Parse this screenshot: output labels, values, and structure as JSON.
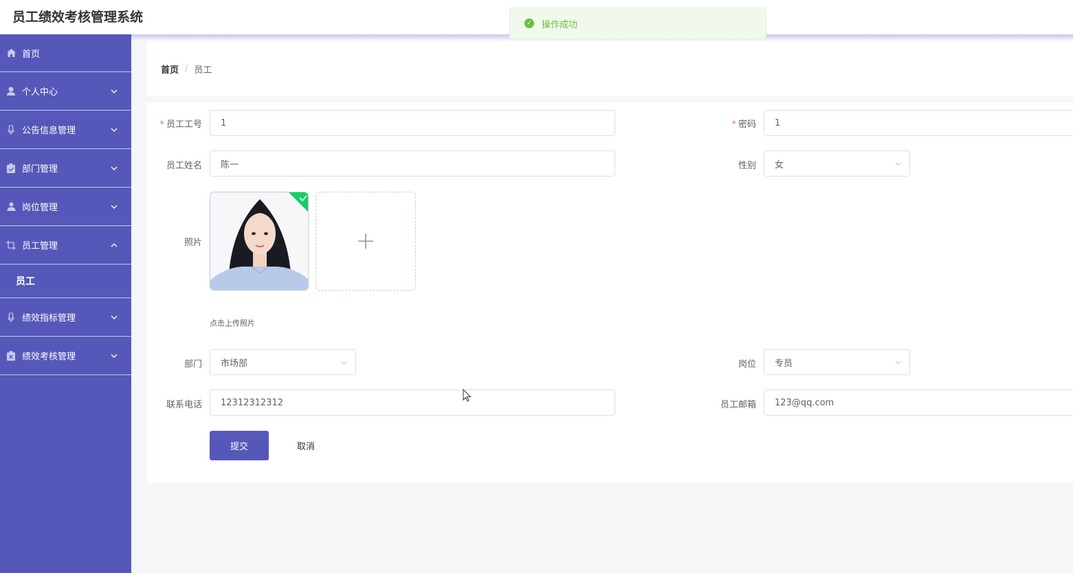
{
  "app": {
    "title": "员工绩效考核管理系统"
  },
  "toast": {
    "message": "操作成功",
    "color": "#67c23a"
  },
  "sidebar": {
    "color": "#5558b8",
    "items": [
      {
        "label": "首页",
        "icon": "home-icon"
      },
      {
        "label": "个人中心",
        "icon": "user-icon"
      },
      {
        "label": "公告信息管理",
        "icon": "microphone-icon"
      },
      {
        "label": "部门管理",
        "icon": "clipboard-icon"
      },
      {
        "label": "岗位管理",
        "icon": "person-icon"
      },
      {
        "label": "员工管理",
        "icon": "crop-icon",
        "expanded": true,
        "children": [
          {
            "label": "员工"
          }
        ]
      },
      {
        "label": "绩效指标管理",
        "icon": "microphone-icon"
      },
      {
        "label": "绩效考核管理",
        "icon": "clipboard-icon"
      }
    ]
  },
  "breadcrumb": {
    "home": "首页",
    "separator": "/",
    "current": "员工"
  },
  "form": {
    "employee_no": {
      "label": "员工工号",
      "value": "1",
      "required": true
    },
    "password": {
      "label": "密码",
      "value": "1",
      "required": true
    },
    "name": {
      "label": "员工姓名",
      "value": "陈一"
    },
    "gender": {
      "label": "性别",
      "value": "女"
    },
    "photo": {
      "label": "照片",
      "hint": "点击上传照片"
    },
    "department": {
      "label": "部门",
      "value": "市场部"
    },
    "position": {
      "label": "岗位",
      "value": "专员"
    },
    "phone": {
      "label": "联系电话",
      "value": "12312312312"
    },
    "email": {
      "label": "员工邮箱",
      "value": "123@qq.com"
    },
    "submit_label": "提交",
    "cancel_label": "取消"
  }
}
